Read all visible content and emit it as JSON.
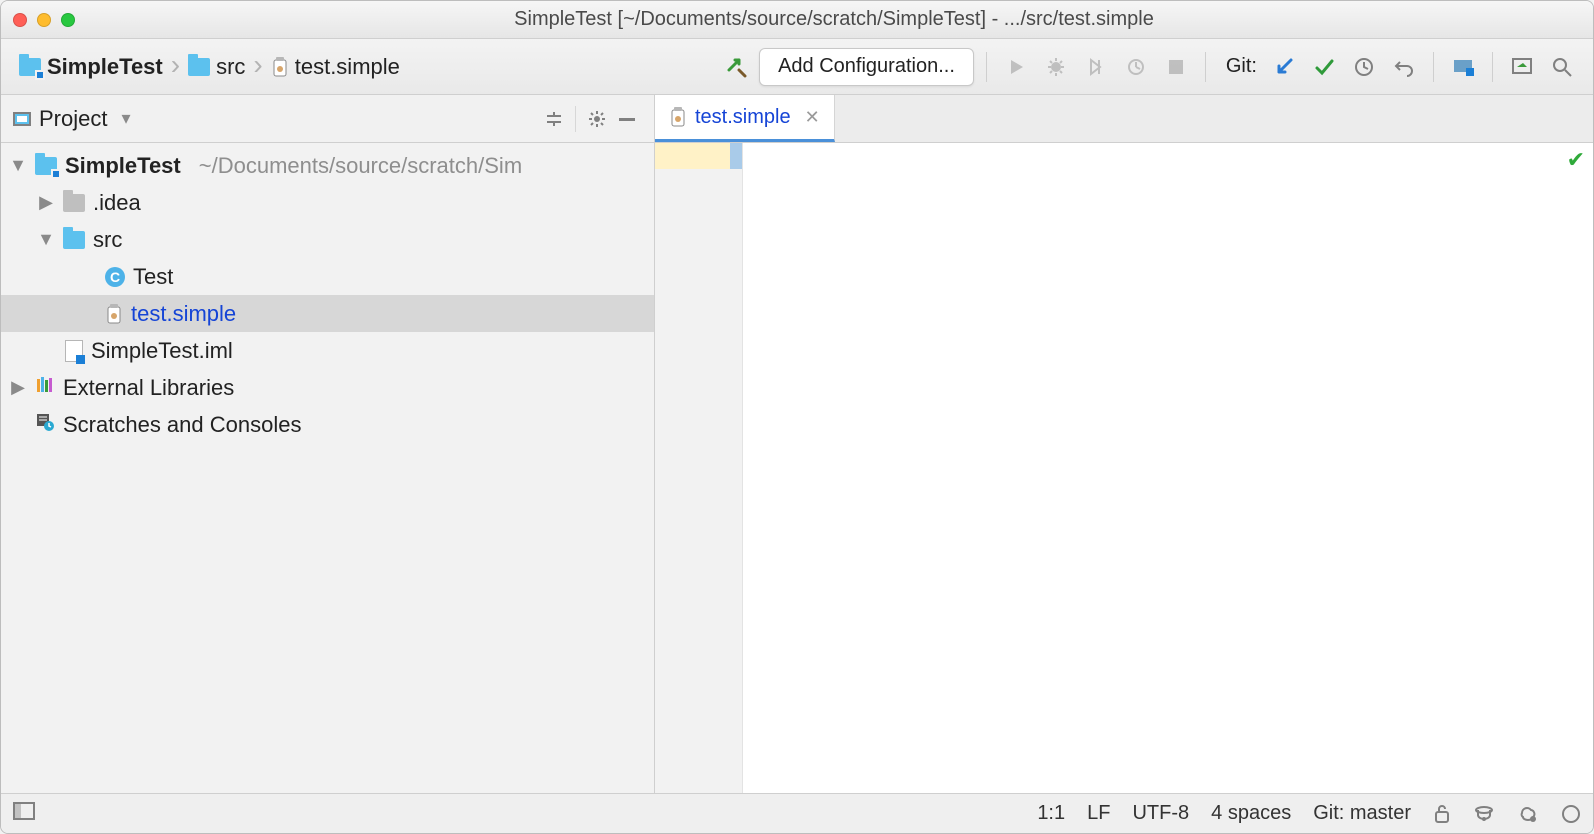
{
  "window": {
    "title": "SimpleTest [~/Documents/source/scratch/SimpleTest] - .../src/test.simple"
  },
  "breadcrumbs": {
    "project": "SimpleTest",
    "folder": "src",
    "file": "test.simple"
  },
  "toolbar": {
    "config_button": "Add Configuration...",
    "git_label": "Git:"
  },
  "panel": {
    "title": "Project"
  },
  "tree": {
    "root_name": "SimpleTest",
    "root_path": "~/Documents/source/scratch/Sim",
    "idea": ".idea",
    "src": "src",
    "test_class": "Test",
    "test_simple": "test.simple",
    "iml": "SimpleTest.iml",
    "ext_libs": "External Libraries",
    "scratches": "Scratches and Consoles"
  },
  "editor": {
    "tab_name": "test.simple"
  },
  "status": {
    "caret": "1:1",
    "eol": "LF",
    "encoding": "UTF-8",
    "indent": "4 spaces",
    "git": "Git: master"
  }
}
